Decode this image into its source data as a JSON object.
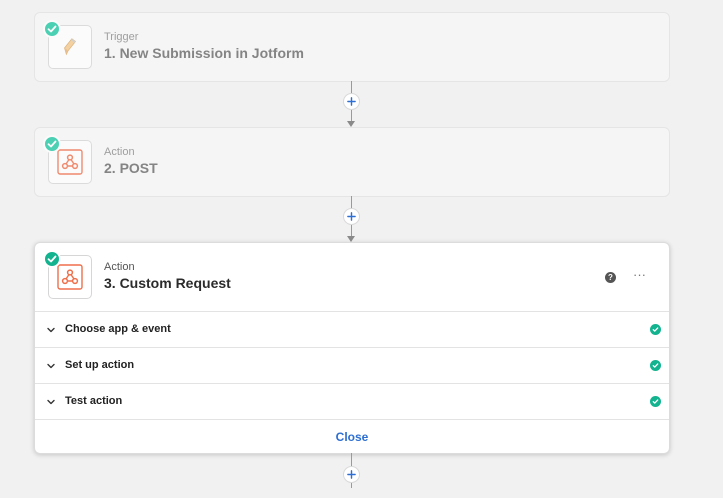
{
  "steps": [
    {
      "kind": "Trigger",
      "title": "1. New Submission in Jotform",
      "app_icon": "jotform-pencil-icon",
      "status": "complete"
    },
    {
      "kind": "Action",
      "title": "2. POST",
      "app_icon": "webhooks-icon",
      "status": "complete"
    },
    {
      "kind": "Action",
      "title": "3. Custom Request",
      "app_icon": "webhooks-icon",
      "status": "complete",
      "help_icon": "?",
      "more_icon": "···",
      "sections": [
        {
          "label": "Choose app & event",
          "status": "complete"
        },
        {
          "label": "Set up action",
          "status": "complete"
        },
        {
          "label": "Test action",
          "status": "complete"
        }
      ],
      "close_label": "Close"
    }
  ],
  "colors": {
    "accent_green": "#13b38f",
    "link_blue": "#2d6fd2",
    "webhook_orange": "#ef6f4b"
  }
}
